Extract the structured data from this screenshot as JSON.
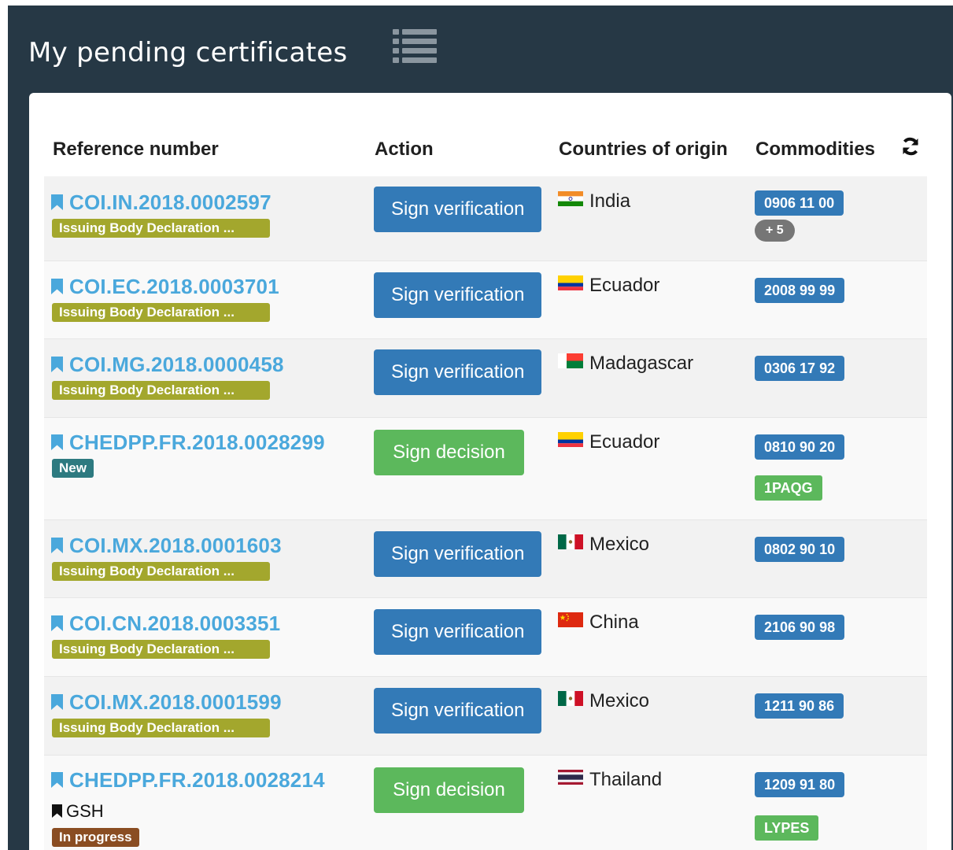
{
  "panel": {
    "title": "My pending certificates"
  },
  "table": {
    "headers": {
      "reference": "Reference number",
      "action": "Action",
      "countries": "Countries of origin",
      "commodities": "Commodities"
    },
    "rows": [
      {
        "ref": "COI.IN.2018.0002597",
        "label": "Issuing Body Declaration ...",
        "action": "Sign verification",
        "country": "India",
        "commodity": "0906 11 00",
        "more": "+ 5"
      },
      {
        "ref": "COI.EC.2018.0003701",
        "label": "Issuing Body Declaration ...",
        "action": "Sign verification",
        "country": "Ecuador",
        "commodity": "2008 99 99"
      },
      {
        "ref": "COI.MG.2018.0000458",
        "label": "Issuing Body Declaration ...",
        "action": "Sign verification",
        "country": "Madagascar",
        "commodity": "0306 17 92"
      },
      {
        "ref": "CHEDPP.FR.2018.0028299",
        "label": "New",
        "action": "Sign decision",
        "country": "Ecuador",
        "commodity": "0810 90 20",
        "code": "1PAQG"
      },
      {
        "ref": "COI.MX.2018.0001603",
        "label": "Issuing Body Declaration ...",
        "action": "Sign verification",
        "country": "Mexico",
        "commodity": "0802 90 10"
      },
      {
        "ref": "COI.CN.2018.0003351",
        "label": "Issuing Body Declaration ...",
        "action": "Sign verification",
        "country": "China",
        "commodity": "2106 90 98"
      },
      {
        "ref": "COI.MX.2018.0001599",
        "label": "Issuing Body Declaration ...",
        "action": "Sign verification",
        "country": "Mexico",
        "commodity": "1211 90 86"
      },
      {
        "ref": "CHEDPP.FR.2018.0028214",
        "bookmark_text": "GSH",
        "label": "In progress",
        "action": "Sign decision",
        "country": "Thailand",
        "commodity": "1209 91 80",
        "code": "LYPES"
      }
    ]
  },
  "colors": {
    "panel_bg": "#263845",
    "link": "#4aa8dc",
    "primary_button": "#337ab7",
    "success_button": "#5cb85c",
    "issuing_label": "#a3a72d",
    "new_label": "#2d7a80",
    "in_progress_label": "#8a4d22"
  },
  "icons": [
    "list-icon",
    "refresh-icon",
    "bookmark-icon",
    "flag-icon"
  ]
}
